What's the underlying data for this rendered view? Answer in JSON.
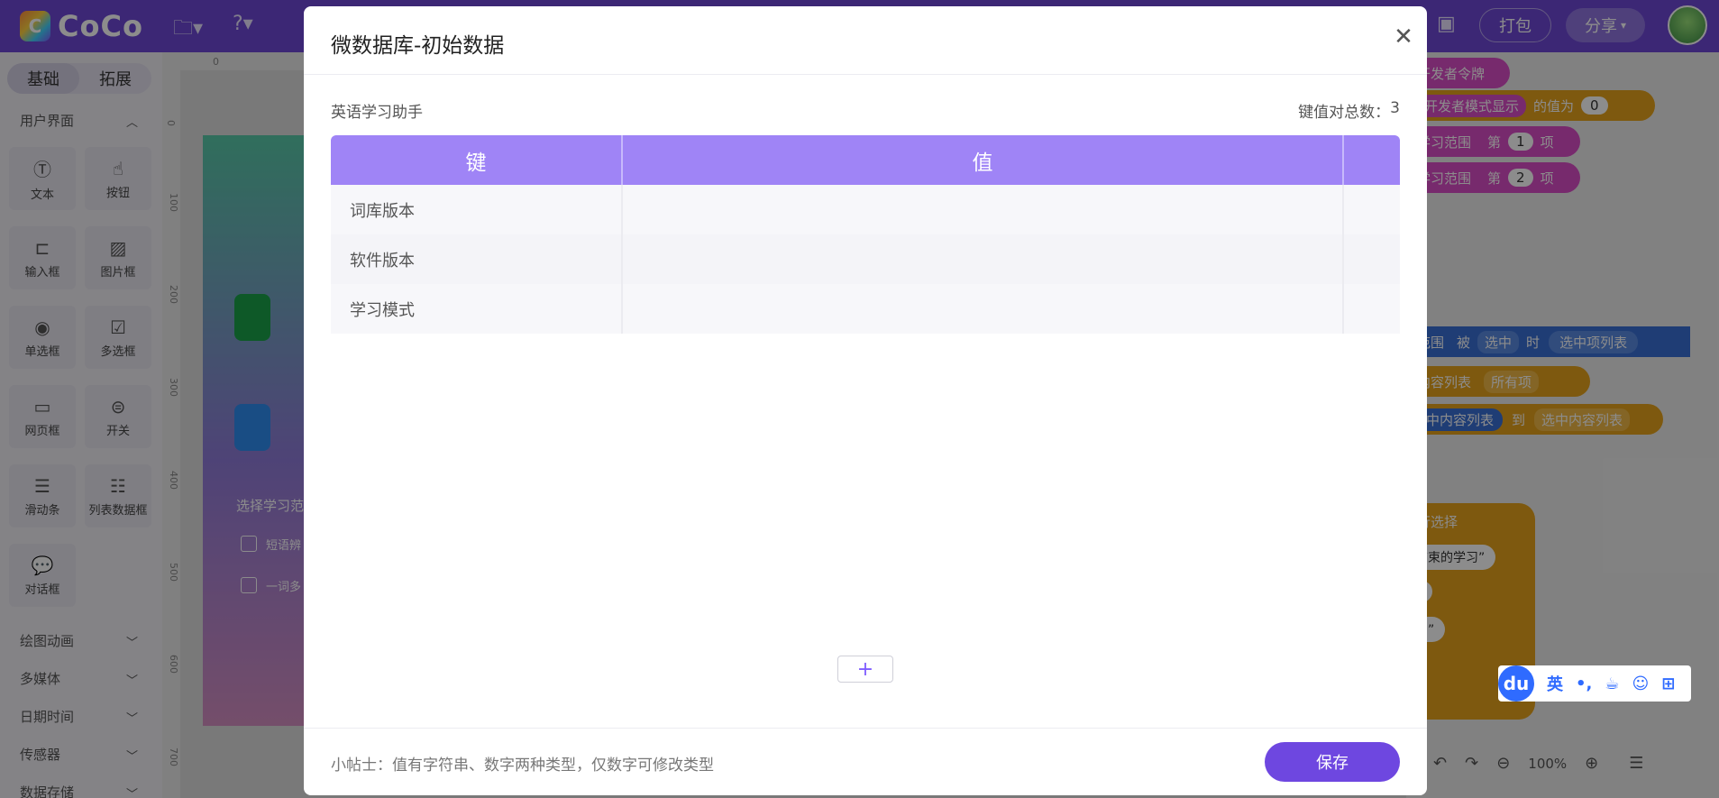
{
  "app": {
    "logo_text": "CoCo",
    "package_label": "打包",
    "share_label": "分享"
  },
  "left_panel": {
    "tabs": [
      "基础",
      "拓展"
    ],
    "section_ui": "用户界面",
    "widgets": [
      {
        "label": "文本",
        "icon": "text-icon"
      },
      {
        "label": "按钮",
        "icon": "button-icon"
      },
      {
        "label": "输入框",
        "icon": "input-icon"
      },
      {
        "label": "图片框",
        "icon": "image-icon"
      },
      {
        "label": "单选框",
        "icon": "radio-icon"
      },
      {
        "label": "多选框",
        "icon": "checkbox-icon"
      },
      {
        "label": "网页框",
        "icon": "webview-icon"
      },
      {
        "label": "开关",
        "icon": "switch-icon"
      },
      {
        "label": "滑动条",
        "icon": "slider-icon"
      },
      {
        "label": "列表数据框",
        "icon": "list-icon"
      },
      {
        "label": "对话框",
        "icon": "dialog-icon"
      }
    ],
    "sections": [
      "绘图动画",
      "多媒体",
      "日期时间",
      "传感器",
      "数据存储"
    ]
  },
  "ruler": {
    "top": [
      "0"
    ],
    "left": [
      "0",
      "100",
      "200",
      "300",
      "400",
      "500",
      "600",
      "700"
    ]
  },
  "canvas_peek": {
    "label": "选择学习范",
    "option1": "短语辨",
    "option2": "一词多"
  },
  "code_blocks": {
    "b1": "开发者令牌",
    "b2": "开发者模式显示",
    "b2_suffix": "的值为",
    "b2_value": "0",
    "b3": "学习范围",
    "b3_mid": "第",
    "b3_num": "1",
    "b3_end": "项",
    "b4": "学习范围",
    "b4_mid": "第",
    "b4_num": "2",
    "b4_end": "项",
    "e1a": "范围",
    "e1b": "被",
    "e1c": "选中",
    "e1d": "时",
    "e1e": "选中项列表",
    "e2a": "内容列表",
    "e2b": "所有项",
    "e3a": "中内容列表",
    "e3b": "到",
    "e3c": "选中内容列表",
    "s1": "行选择",
    "s2": "结束的学习”",
    "s3": "”",
    "s4": "习”",
    "zoom": "100%"
  },
  "ime": {
    "logo": "du",
    "lang": "英",
    "punct": "•,"
  },
  "modal": {
    "title": "微数据库-初始数据",
    "db_name": "英语学习助手",
    "pair_count_label": "键值对总数：",
    "pair_count": "3",
    "table": {
      "headers": [
        "键",
        "值",
        ""
      ],
      "rows": [
        {
          "key": "词库版本",
          "value": ""
        },
        {
          "key": "软件版本",
          "value": ""
        },
        {
          "key": "学习模式",
          "value": ""
        }
      ]
    },
    "add_symbol": "+",
    "tip": "小帖士：值有字符串、数字两种类型，仅数字可修改类型",
    "save_label": "保存"
  }
}
